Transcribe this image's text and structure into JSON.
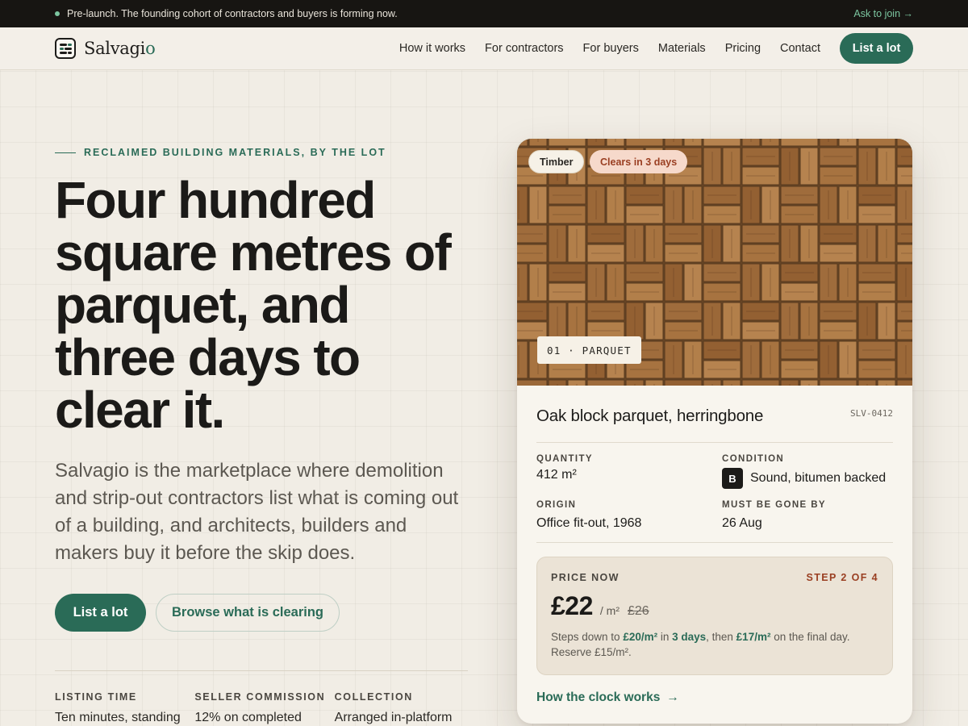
{
  "announcement": {
    "text": "Pre-launch. The founding cohort of contractors and buyers is forming now.",
    "link_label": "Ask to join →"
  },
  "nav": {
    "logo_name": "Salvagi",
    "logo_accent": "o",
    "links": [
      "How it works",
      "For contractors",
      "For buyers",
      "Materials",
      "Pricing",
      "Contact"
    ],
    "cta": "List a lot"
  },
  "hero": {
    "eyebrow": "RECLAIMED BUILDING MATERIALS, BY THE LOT",
    "headline": "Four hundred square metres of parquet, and three days to clear it.",
    "lede": "Salvagio is the marketplace where demolition and strip-out contractors list what is coming out of a building, and architects, builders and makers buy it before the skip does.",
    "primary_cta": "List a lot",
    "secondary_cta": "Browse what is clearing",
    "stats": [
      {
        "label": "LISTING TIME",
        "value": "Ten minutes, standing"
      },
      {
        "label": "SELLER COMMISSION",
        "value": "12% on completed"
      },
      {
        "label": "COLLECTION",
        "value": "Arranged in-platform"
      }
    ]
  },
  "lot_card": {
    "category_chip": "Timber",
    "urgency_chip": "Clears in 3 days",
    "plate": "01 · PARQUET",
    "title": "Oak block parquet, herringbone",
    "sku": "SLV-0412",
    "fields": {
      "quantity_label": "QUANTITY",
      "quantity_value": "412 m²",
      "condition_label": "CONDITION",
      "condition_grade": "B",
      "condition_value": "Sound, bitumen backed",
      "origin_label": "ORIGIN",
      "origin_value": "Office fit-out, 1968",
      "deadline_label": "MUST BE GONE BY",
      "deadline_value": "26 Aug"
    },
    "price": {
      "label": "PRICE NOW",
      "step": "STEP 2 OF 4",
      "current": "£22",
      "unit": "/ m²",
      "previous": "£26",
      "note_1": "Steps down to ",
      "next_price": "£20/m²",
      "note_2": " in ",
      "next_days": "3 days",
      "note_3": ", then ",
      "final_price": "£17/m²",
      "note_4": " on the final day.",
      "reserve": "Reserve £15/m²."
    },
    "link": "How the clock works",
    "link_arrow": "→"
  },
  "colors": {
    "accent": "#2a6b57",
    "warning": "#9a3f22",
    "topbar": "#171512",
    "background": "#f1ede5"
  },
  "icons": [
    "salvagio-logo-icon",
    "status-dot-icon",
    "arrow-right-icon"
  ]
}
